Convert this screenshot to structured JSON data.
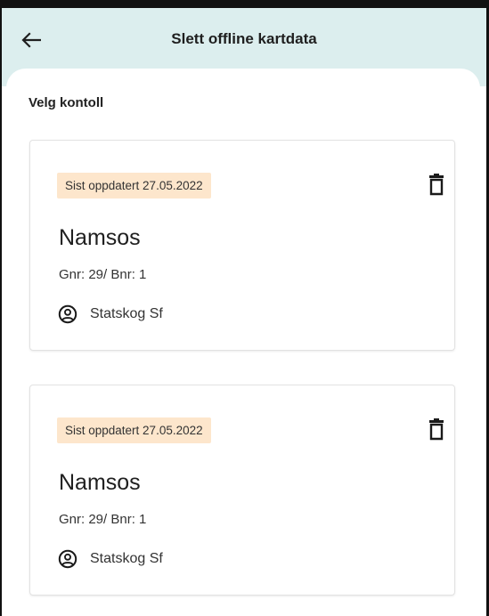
{
  "app_bar": {
    "title": "Slett offline kartdata",
    "back_icon": "arrow-left-icon",
    "background": "#dceeee"
  },
  "section": {
    "label": "Velg kontoll"
  },
  "cards": [
    {
      "badge": "Sist oppdatert 27.05.2022",
      "place": "Namsos",
      "property": "Gnr: 29/ Bnr: 1",
      "owner": "Statskog Sf",
      "delete_icon": "trash-icon",
      "owner_icon": "account-circle-icon"
    },
    {
      "badge": "Sist oppdatert 27.05.2022",
      "place": "Namsos",
      "property": "Gnr: 29/ Bnr: 1",
      "owner": "Statskog Sf",
      "delete_icon": "trash-icon",
      "owner_icon": "account-circle-icon"
    }
  ],
  "colors": {
    "badge_bg": "#fde6cc",
    "text": "#1f1f1f"
  }
}
